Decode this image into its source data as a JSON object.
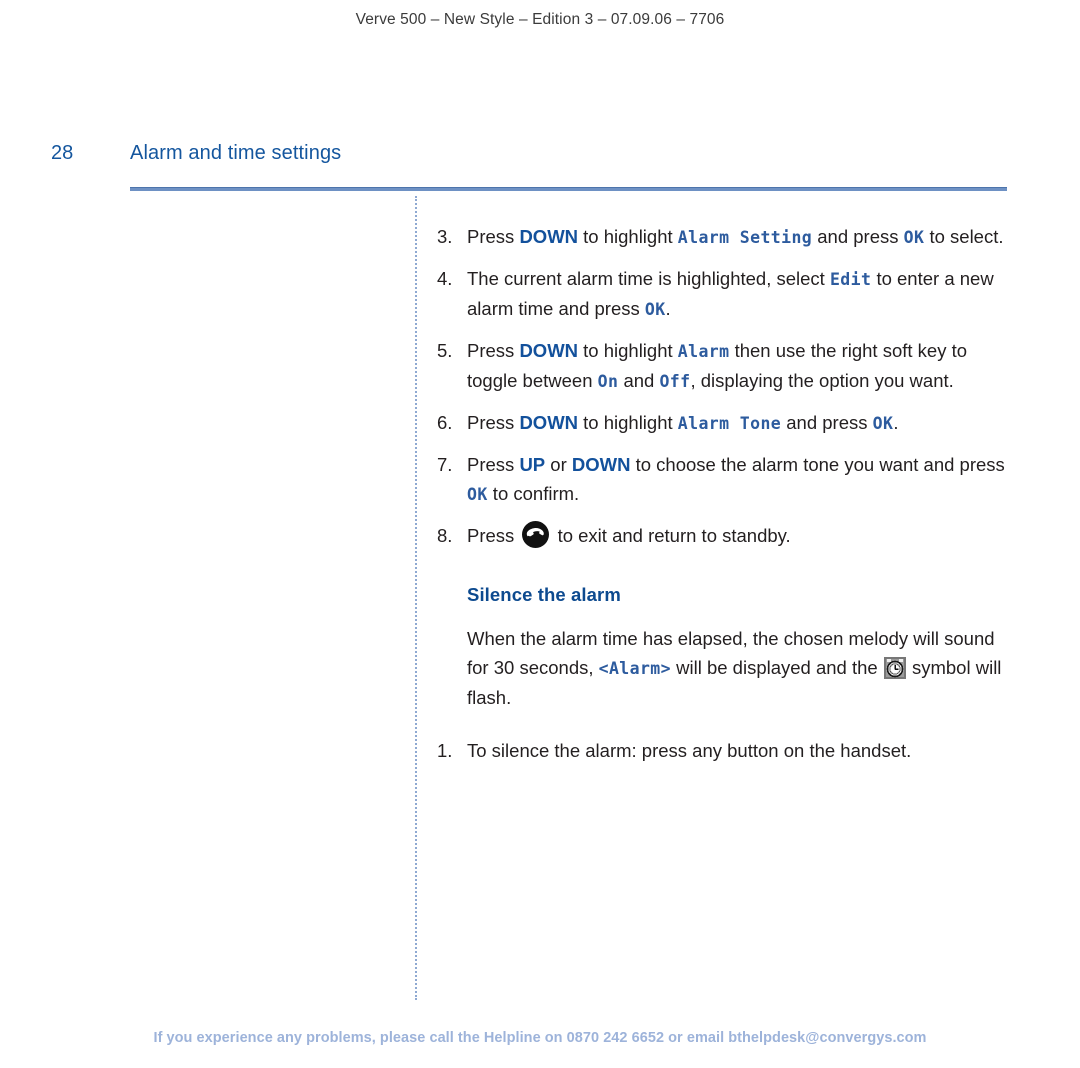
{
  "header": {
    "running_head": "Verve 500 – New Style – Edition 3 – 07.09.06 – 7706"
  },
  "title_row": {
    "page_number": "28",
    "page_title": "Alarm and time settings"
  },
  "colors": {
    "heading_blue": "#14569e",
    "keyword_blue": "#13519c",
    "lcd_blue": "#2d5b9e",
    "rule_blue": "#6e91c4",
    "dotted_blue": "#8fa9d2",
    "footer_blue": "#9db3da",
    "body_text": "#231f20"
  },
  "steps": [
    {
      "num": "3.",
      "parts": [
        {
          "t": "text",
          "v": "Press "
        },
        {
          "t": "kbd",
          "v": "DOWN"
        },
        {
          "t": "text",
          "v": " to highlight "
        },
        {
          "t": "lcd",
          "v": "Alarm Setting"
        },
        {
          "t": "text",
          "v": " and press "
        },
        {
          "t": "lcd",
          "v": "OK"
        },
        {
          "t": "text",
          "v": " to select."
        }
      ]
    },
    {
      "num": "4.",
      "parts": [
        {
          "t": "text",
          "v": "The current alarm time is highlighted, select "
        },
        {
          "t": "lcd",
          "v": "Edit"
        },
        {
          "t": "text",
          "v": " to enter a new alarm time and press "
        },
        {
          "t": "lcd",
          "v": "OK"
        },
        {
          "t": "text",
          "v": "."
        }
      ]
    },
    {
      "num": "5.",
      "parts": [
        {
          "t": "text",
          "v": "Press "
        },
        {
          "t": "kbd",
          "v": "DOWN"
        },
        {
          "t": "text",
          "v": " to highlight "
        },
        {
          "t": "lcd",
          "v": "Alarm"
        },
        {
          "t": "text",
          "v": " then use the right soft key to toggle between "
        },
        {
          "t": "lcd",
          "v": "On"
        },
        {
          "t": "text",
          "v": " and "
        },
        {
          "t": "lcd",
          "v": "Off"
        },
        {
          "t": "text",
          "v": ", displaying the option you want."
        }
      ]
    },
    {
      "num": "6.",
      "parts": [
        {
          "t": "text",
          "v": "Press "
        },
        {
          "t": "kbd",
          "v": "DOWN"
        },
        {
          "t": "text",
          "v": " to highlight "
        },
        {
          "t": "lcd",
          "v": "Alarm Tone"
        },
        {
          "t": "text",
          "v": " and press "
        },
        {
          "t": "lcd",
          "v": "OK"
        },
        {
          "t": "text",
          "v": "."
        }
      ]
    },
    {
      "num": "7.",
      "parts": [
        {
          "t": "text",
          "v": "Press "
        },
        {
          "t": "kbd",
          "v": "UP"
        },
        {
          "t": "text",
          "v": " or "
        },
        {
          "t": "kbd",
          "v": "DOWN"
        },
        {
          "t": "text",
          "v": " to choose the alarm tone you want and press "
        },
        {
          "t": "lcd",
          "v": "OK"
        },
        {
          "t": "text",
          "v": " to confirm."
        }
      ]
    },
    {
      "num": "8.",
      "parts": [
        {
          "t": "text",
          "v": "Press "
        },
        {
          "t": "icon",
          "v": "end-call-icon"
        },
        {
          "t": "text",
          "v": " to exit and return to standby."
        }
      ]
    }
  ],
  "section": {
    "heading": "Silence the alarm",
    "paragraph_parts": [
      {
        "t": "text",
        "v": "When the alarm time has elapsed, the chosen melody will sound for 30 seconds, "
      },
      {
        "t": "lcd",
        "v": "<Alarm>"
      },
      {
        "t": "text",
        "v": " will be displayed and the "
      },
      {
        "t": "icon",
        "v": "alarm-clock-icon"
      },
      {
        "t": "text",
        "v": " symbol will flash."
      }
    ],
    "steps2": [
      {
        "num": "1.",
        "parts": [
          {
            "t": "text",
            "v": "To silence the alarm: press any button on the handset."
          }
        ]
      }
    ]
  },
  "footer": {
    "text": "If you experience any problems, please call the Helpline on 0870 242 6652 or email bthelpdesk@convergys.com"
  }
}
